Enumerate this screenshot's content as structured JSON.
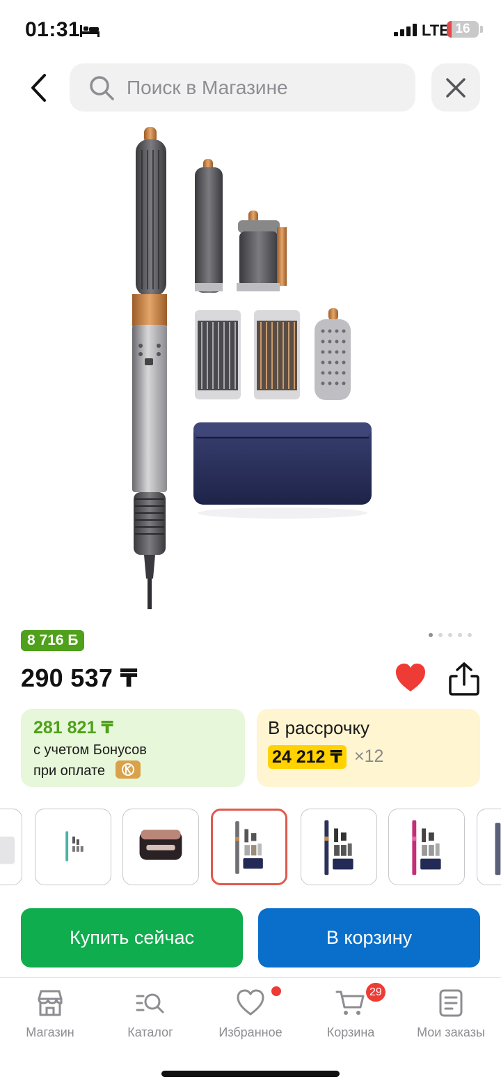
{
  "status_bar": {
    "time": "01:31",
    "network": "LTE",
    "battery_level": "16",
    "battery_fraction": 0.16
  },
  "header": {
    "back_icon": "chevron-left-icon",
    "search": {
      "placeholder": "Поиск в Магазине",
      "icon": "search-icon"
    },
    "close_icon": "close-icon"
  },
  "gallery": {
    "image": "dyson-airwrap-complete-set",
    "pages": 5,
    "active_page": 1
  },
  "product": {
    "bonus_badge": "8 716 Б",
    "price": "290 537 ₸",
    "favorite_active": true,
    "colors": {
      "price_green": "#4fa01a",
      "favorite_red": "#ef3b35"
    }
  },
  "bonus_card": {
    "price": "281 821 ₸",
    "line1": "с учетом Бонусов",
    "line2": "при оплате"
  },
  "installment_card": {
    "title": "В рассрочку",
    "amount": "24 212 ₸",
    "multiplier": "×12"
  },
  "variants": {
    "selected_index": 3,
    "items": [
      "variant-white",
      "variant-teal",
      "variant-case",
      "variant-copper",
      "variant-blue",
      "variant-pink",
      "variant-more"
    ]
  },
  "actions": {
    "buy_now": "Купить сейчас",
    "add_to_cart": "В корзину",
    "colors": {
      "buy_now": "#10ad4e",
      "add_to_cart": "#0a6fcb"
    }
  },
  "tabbar": {
    "items": [
      {
        "label": "Магазин",
        "icon": "store-icon"
      },
      {
        "label": "Каталог",
        "icon": "catalog-search-icon"
      },
      {
        "label": "Избранное",
        "icon": "heart-outline-icon"
      },
      {
        "label": "Корзина",
        "icon": "cart-icon"
      },
      {
        "label": "Мои заказы",
        "icon": "orders-icon"
      }
    ],
    "cart_count": "29"
  }
}
